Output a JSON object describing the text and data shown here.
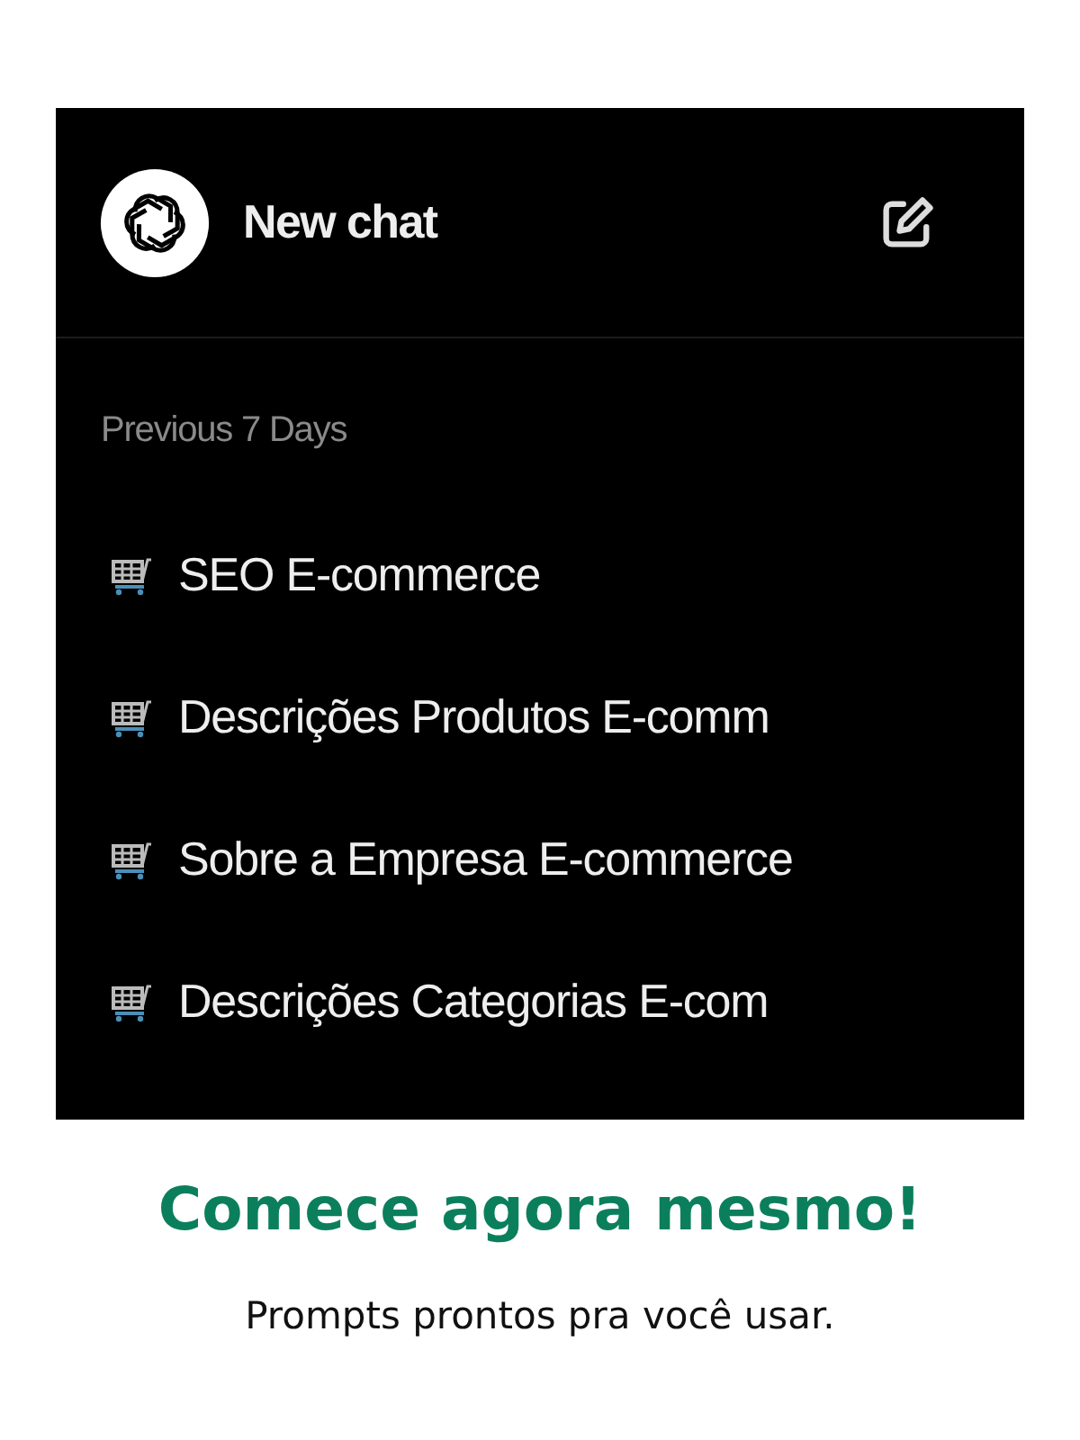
{
  "sidebar": {
    "new_chat": {
      "label": "New chat"
    },
    "section": "Previous 7 Days",
    "items": [
      {
        "label": "SEO E-commerce"
      },
      {
        "label": "Descrições Produtos E-comm"
      },
      {
        "label": "Sobre a Empresa E-commerce"
      },
      {
        "label": "Descrições Categorias E-com"
      }
    ]
  },
  "heading": "Comece agora mesmo!",
  "subtitle": "Prompts prontos pra você usar."
}
